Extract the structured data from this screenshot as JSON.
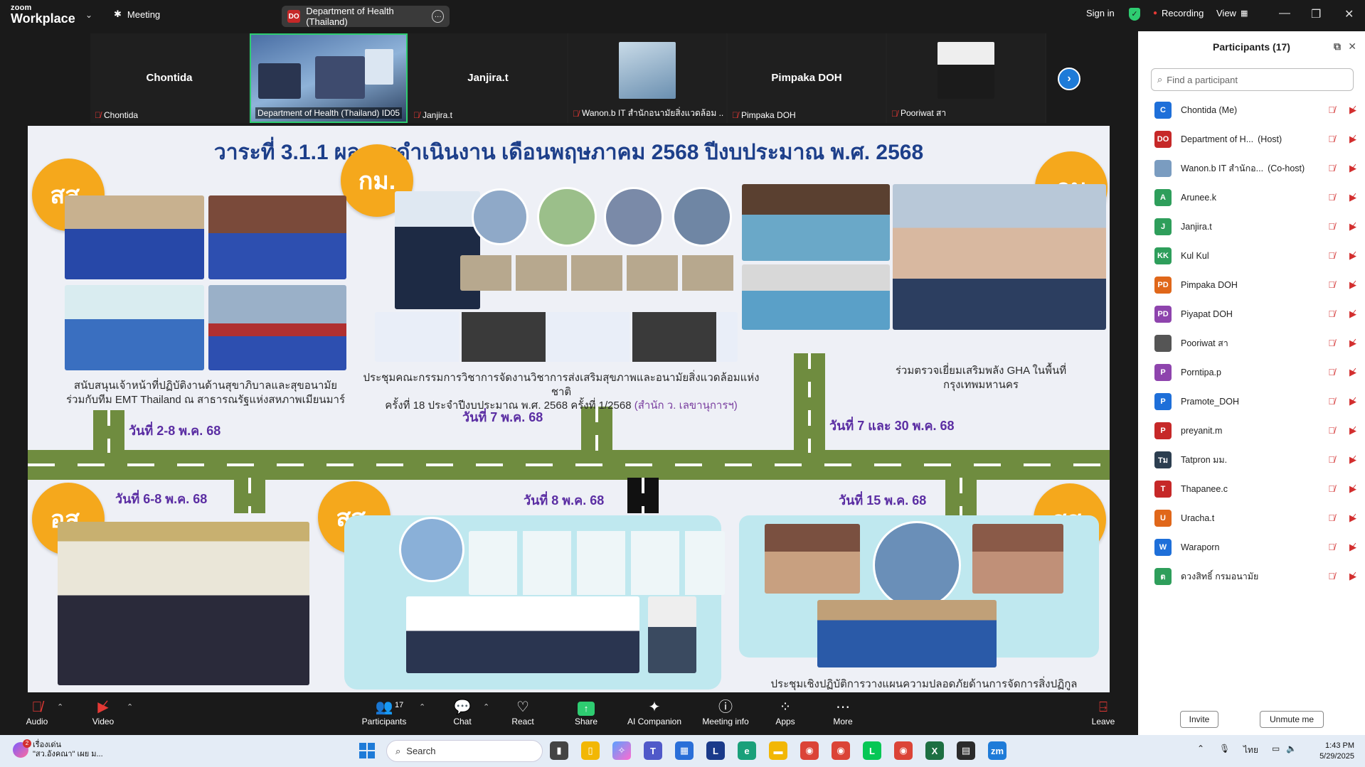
{
  "titlebar": {
    "logo_top": "zoom",
    "logo_bottom": "Workplace",
    "meeting_label": "Meeting",
    "tab_badge": "DO",
    "tab_title": "Department of Health (Thailand)",
    "sign_in": "Sign in",
    "recording": "Recording",
    "view": "View"
  },
  "strip": {
    "tiles": [
      {
        "name": "Chontida",
        "label": "Chontida"
      },
      {
        "name": "",
        "label": "Department of Health (Thailand) ID05"
      },
      {
        "name": "Janjira.t",
        "label": "Janjira.t"
      },
      {
        "name": "",
        "label": "Wanon.b IT สำนักอนามัยสิ่งแวดล้อม ..."
      },
      {
        "name": "Pimpaka DOH",
        "label": "Pimpaka DOH"
      },
      {
        "name": "",
        "label": "Pooriwat สา"
      }
    ]
  },
  "slide": {
    "title": "วาระที่ 3.1.1 ผลการดำเนินงาน เดือนพฤษภาคม 2568 ปีงบประมาณ พ.ศ. 2568",
    "badges": [
      "สส.",
      "กม.",
      "กม",
      "อส.",
      "สส.",
      "สส."
    ],
    "caption1_l1": "สนับสนุนเจ้าหน้าที่ปฏิบัติงานด้านสุขาภิบาลและสุขอนามัย",
    "caption1_l2": "ร่วมกับทีม EMT Thailand ณ สาธารณรัฐแห่งสหภาพเมียนมาร์",
    "caption2_l1": "ประชุมคณะกรรมการวิชาการจัดงานวิชาการส่งเสริมสุขภาพและอนามัยสิ่งแวดล้อมแห่งชาติ",
    "caption2_l2": "ครั้งที่ 18 ประจำปีงบประมาณ พ.ศ. 2568 ครั้งที่ 1/2568",
    "caption2_hl": "(สำนัก ว. เลขานุการฯ)",
    "caption3_l1": "ร่วมตรวจเยี่ยมเสริมพลัง GHA ในพื้นที่",
    "caption3_l2": "กรุงเทพมหานคร",
    "date1": "วันที่ 2-8 พ.ค. 68",
    "date2": "วันที่ 7 พ.ค. 68",
    "date3": "วันที่ 7 และ 30 พ.ค. 68",
    "date4": "วันที่ 6-8 พ.ค. 68",
    "date5": "วันที่ 8 พ.ค. 68",
    "date6": "วันที่ 15 พ.ค. 68",
    "caption6_l1": "ประชุมเชิงปฏิบัติการวางแผนความปลอดภัยด้านการจัดการสิ่งปฏิกูล"
  },
  "panel": {
    "title": "Participants (17)",
    "search_placeholder": "Find a participant",
    "participants": [
      {
        "initials": "C",
        "name": "Chontida (Me)",
        "role": "",
        "color": "#1e6fd9"
      },
      {
        "initials": "DO",
        "name": "Department of H...",
        "role": "(Host)",
        "color": "#c62828"
      },
      {
        "initials": "",
        "name": "Wanon.b IT สำนักอ...",
        "role": "(Co-host)",
        "color": "#7a9cc0"
      },
      {
        "initials": "A",
        "name": "Arunee.k",
        "role": "",
        "color": "#2e9e5b"
      },
      {
        "initials": "J",
        "name": "Janjira.t",
        "role": "",
        "color": "#2e9e5b"
      },
      {
        "initials": "KK",
        "name": "Kul Kul",
        "role": "",
        "color": "#2e9e5b"
      },
      {
        "initials": "PD",
        "name": "Pimpaka DOH",
        "role": "",
        "color": "#e0671a"
      },
      {
        "initials": "PD",
        "name": "Piyapat DOH",
        "role": "",
        "color": "#8e44ad"
      },
      {
        "initials": "",
        "name": "Pooriwat สา",
        "role": "",
        "color": "#555555"
      },
      {
        "initials": "P",
        "name": "Porntipa.p",
        "role": "",
        "color": "#8e44ad"
      },
      {
        "initials": "P",
        "name": "Pramote_DOH",
        "role": "",
        "color": "#1e6fd9"
      },
      {
        "initials": "P",
        "name": "preyanit.m",
        "role": "",
        "color": "#c62828"
      },
      {
        "initials": "Tม",
        "name": "Tatpron มม.",
        "role": "",
        "color": "#2c3e50"
      },
      {
        "initials": "T",
        "name": "Thapanee.c",
        "role": "",
        "color": "#c62828"
      },
      {
        "initials": "U",
        "name": "Uracha.t",
        "role": "",
        "color": "#e0671a"
      },
      {
        "initials": "W",
        "name": "Waraporn",
        "role": "",
        "color": "#1e6fd9"
      },
      {
        "initials": "ต",
        "name": "ดวงสิทธิ์ กรมอนามัย",
        "role": "",
        "color": "#2e9e5b"
      }
    ],
    "invite": "Invite",
    "unmute_me": "Unmute me"
  },
  "toolbar": {
    "audio": "Audio",
    "video": "Video",
    "participants": "Participants",
    "participants_count": "17",
    "chat": "Chat",
    "react": "React",
    "share": "Share",
    "ai_companion": "AI Companion",
    "meeting_info": "Meeting info",
    "apps": "Apps",
    "more": "More",
    "leave": "Leave"
  },
  "taskbar": {
    "news_count": "2",
    "news_title": "เรื่องเด่น",
    "news_sub": "\"สว.อังคณา\" เผย ม...",
    "search": "Search",
    "lang": "ไทย",
    "time": "1:43 PM",
    "date": "5/29/2025"
  },
  "colors": {
    "zoom_blue": "#1e7bd8",
    "recording_red": "#e53935",
    "badge_orange": "#f5a81c",
    "title_blue": "#1d3f8a",
    "date_purple": "#5b2ea3",
    "road_green": "#6f8c3f"
  }
}
